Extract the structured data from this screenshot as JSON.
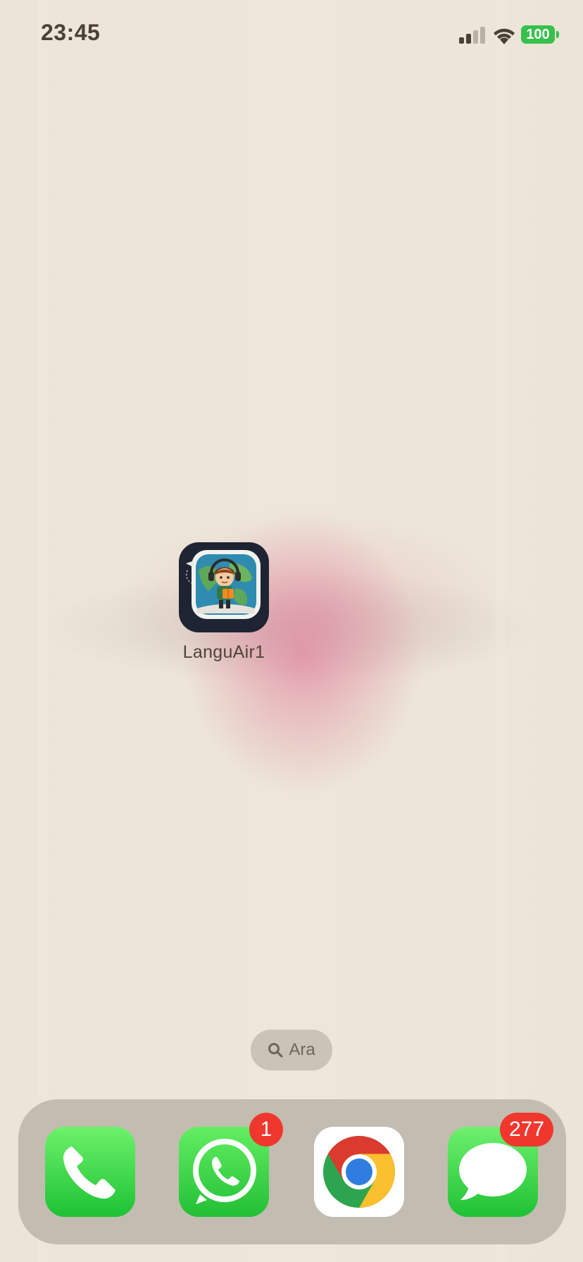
{
  "status_bar": {
    "time": "23:45",
    "battery_level": "100",
    "signal_bars_active": 2,
    "signal_bars_total": 4,
    "icons": [
      "signal-icon",
      "wifi-icon",
      "battery-icon"
    ]
  },
  "home": {
    "apps": [
      {
        "label": "LanguAir1",
        "icon": "languair-app-icon"
      }
    ]
  },
  "search": {
    "label": "Ara",
    "icon": "search-icon"
  },
  "dock": {
    "apps": [
      {
        "name": "Phone",
        "icon": "phone-icon",
        "badge": ""
      },
      {
        "name": "WhatsApp",
        "icon": "whatsapp-icon",
        "badge": "1"
      },
      {
        "name": "Chrome",
        "icon": "chrome-icon",
        "badge": ""
      },
      {
        "name": "Messages",
        "icon": "messages-icon",
        "badge": "277"
      }
    ]
  },
  "colors": {
    "battery": "#37c04c",
    "badge": "#f0372e",
    "dock_background": "#c2bdb0",
    "wallpaper": "#ece6d8"
  }
}
